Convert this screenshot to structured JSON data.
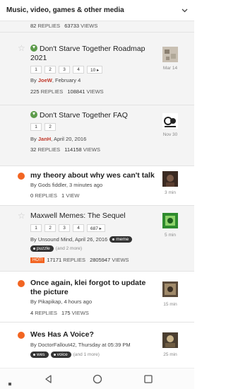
{
  "header": {
    "title": "Music, video, games & other media"
  },
  "top_row": {
    "replies": "82",
    "replies_label": "REPLIES",
    "views": "63733",
    "views_label": "VIEWS"
  },
  "topics": [
    {
      "title": "Don't Starve Together Roadmap 2021",
      "pages": [
        "1",
        "2",
        "3",
        "4",
        "10 ▸"
      ],
      "author_prefix": "By",
      "author": "JoeW",
      "date": ", February 4",
      "replies": "225",
      "replies_label": "REPLIES",
      "views": "108841",
      "views_label": "VIEWS",
      "time": "Mar 14"
    },
    {
      "title": "Don't Starve Together FAQ",
      "pages": [
        "1",
        "2"
      ],
      "author_prefix": "By",
      "author": "JanH",
      "date": ", April 20, 2016",
      "replies": "32",
      "replies_label": "REPLIES",
      "views": "114158",
      "views_label": "VIEWS",
      "time": "Nov 30"
    },
    {
      "title": "my theory about why wes can't talk",
      "meta": "By Gods fiddler, 3 minutes ago",
      "replies": "0",
      "replies_label": "REPLIES",
      "views": "1",
      "views_label": "VIEW",
      "time": "3 min"
    },
    {
      "title": "Maxwell Memes: The Sequel",
      "pages": [
        "1",
        "2",
        "3",
        "4",
        "687 ▸"
      ],
      "meta": "By Unsound Mind, April 26, 2016",
      "tag_first": "meme",
      "tag_second": "puzzle",
      "tags_more": "(and 2 more)",
      "hot_label": "HOT!",
      "replies": "17171",
      "replies_label": "REPLIES",
      "views": "2805947",
      "views_label": "VIEWS",
      "time": "5 min"
    },
    {
      "title": "Once again, klei forgot to update the picture",
      "meta": "By Pikapikap, 4 hours ago",
      "replies": "4",
      "replies_label": "REPLIES",
      "views": "175",
      "views_label": "VIEWS",
      "time": "15 min"
    },
    {
      "title": "Wes Has A Voice?",
      "meta": "By DoctorFallout42, Thursday at 05:39 PM",
      "tag_first": "wes",
      "tag_second": "voice",
      "tags_more": "(and 1 more)",
      "time": "25 min"
    }
  ],
  "colors": {
    "unread_dot": "#f26522",
    "pinned": "#5c9b4a",
    "author_highlight": "#c0392b"
  }
}
